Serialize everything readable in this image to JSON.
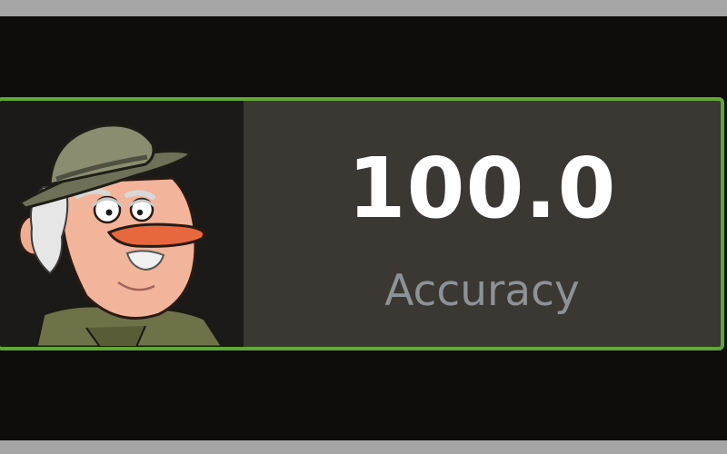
{
  "stat_card": {
    "score": "100.0",
    "label": "Accuracy"
  },
  "avatar": {
    "icon": "cartoon-old-man-with-hat"
  },
  "colors": {
    "card_border": "#5fa838",
    "card_background": "#3b3733",
    "score_text": "#ffffff",
    "label_text": "#8d9296"
  }
}
